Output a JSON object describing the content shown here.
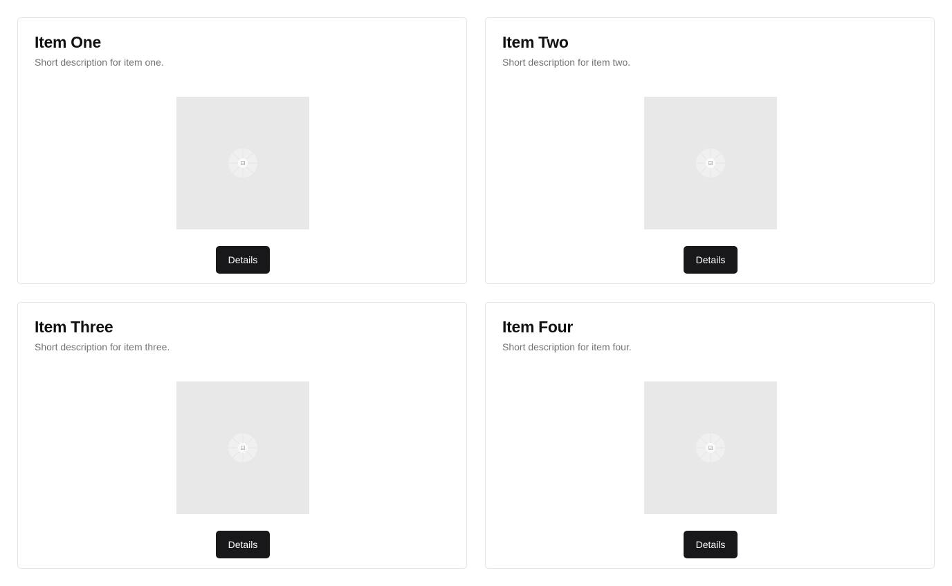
{
  "cards": [
    {
      "title": "Item One",
      "description": "Short description for item one.",
      "image_icon": "image-placeholder-icon",
      "button_label": "Details"
    },
    {
      "title": "Item Two",
      "description": "Short description for item two.",
      "image_icon": "image-placeholder-icon",
      "button_label": "Details"
    },
    {
      "title": "Item Three",
      "description": "Short description for item three.",
      "image_icon": "image-placeholder-icon",
      "button_label": "Details"
    },
    {
      "title": "Item Four",
      "description": "Short description for item four.",
      "image_icon": "image-placeholder-icon",
      "button_label": "Details"
    }
  ],
  "colors": {
    "button_background": "#18181b",
    "button_text": "#ffffff",
    "title_text": "#111111",
    "description_text": "#737373",
    "image_placeholder": "#e8e8e8",
    "card_border": "#e5e5e5"
  }
}
